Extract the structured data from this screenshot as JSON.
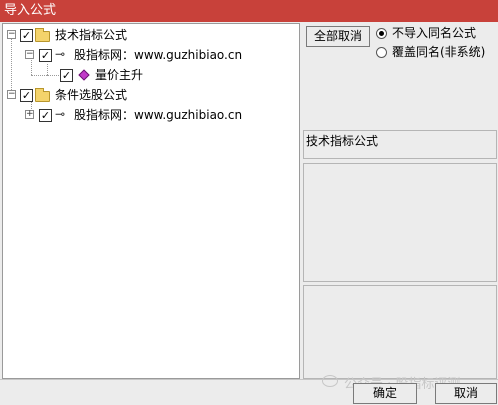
{
  "window": {
    "title": "导入公式"
  },
  "tree": {
    "nodes": {
      "tech": {
        "label": "技术指标公式",
        "expander": "−",
        "checked": "✓"
      },
      "tech_source": {
        "label": "股指标网：www.guzhibiao.cn",
        "expander": "−",
        "checked": "✓"
      },
      "tech_formula": {
        "label": "量价主升",
        "checked": "✓"
      },
      "condition": {
        "label": "条件选股公式",
        "expander": "−",
        "checked": "✓"
      },
      "cond_source": {
        "label": "股指标网：www.guzhibiao.cn",
        "expander": "+",
        "checked": "✓"
      }
    }
  },
  "options": {
    "cancel_all_label": "全部取消",
    "radio_no_import": "不导入同名公式",
    "radio_overwrite": "覆盖同名(非系统)",
    "selected": "no_import"
  },
  "info": {
    "title": "技术指标公式"
  },
  "footer": {
    "ok_label": "确定",
    "cancel_label": "取消",
    "watermark": "公众号 · 股指标评测"
  },
  "colors": {
    "titlebar": "#c8413a",
    "folder": "#f4d36b",
    "formula_gem": "#c23ac9"
  },
  "icons": {
    "folder": "folder-icon",
    "key": "key-icon",
    "formula": "formula-gem-icon"
  }
}
